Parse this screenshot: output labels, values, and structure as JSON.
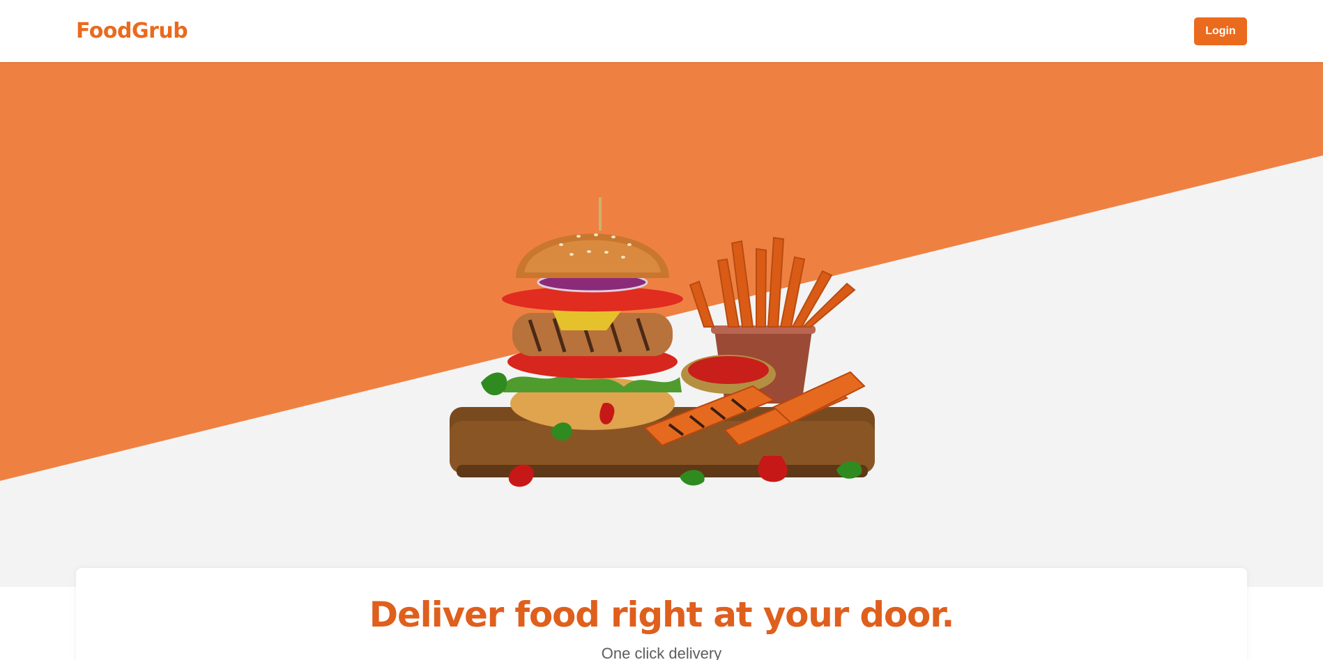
{
  "header": {
    "brand": "FoodGrub",
    "login_label": "Login"
  },
  "hero": {
    "image_alt": "burger-and-sweet-potato-fries"
  },
  "card": {
    "headline": "Deliver food right at your door.",
    "subline": "One click delivery"
  },
  "colors": {
    "accent": "#ea6a1e",
    "hero_orange": "#ee8142",
    "hero_gray": "#f3f3f3",
    "headline": "#df5f1d"
  }
}
